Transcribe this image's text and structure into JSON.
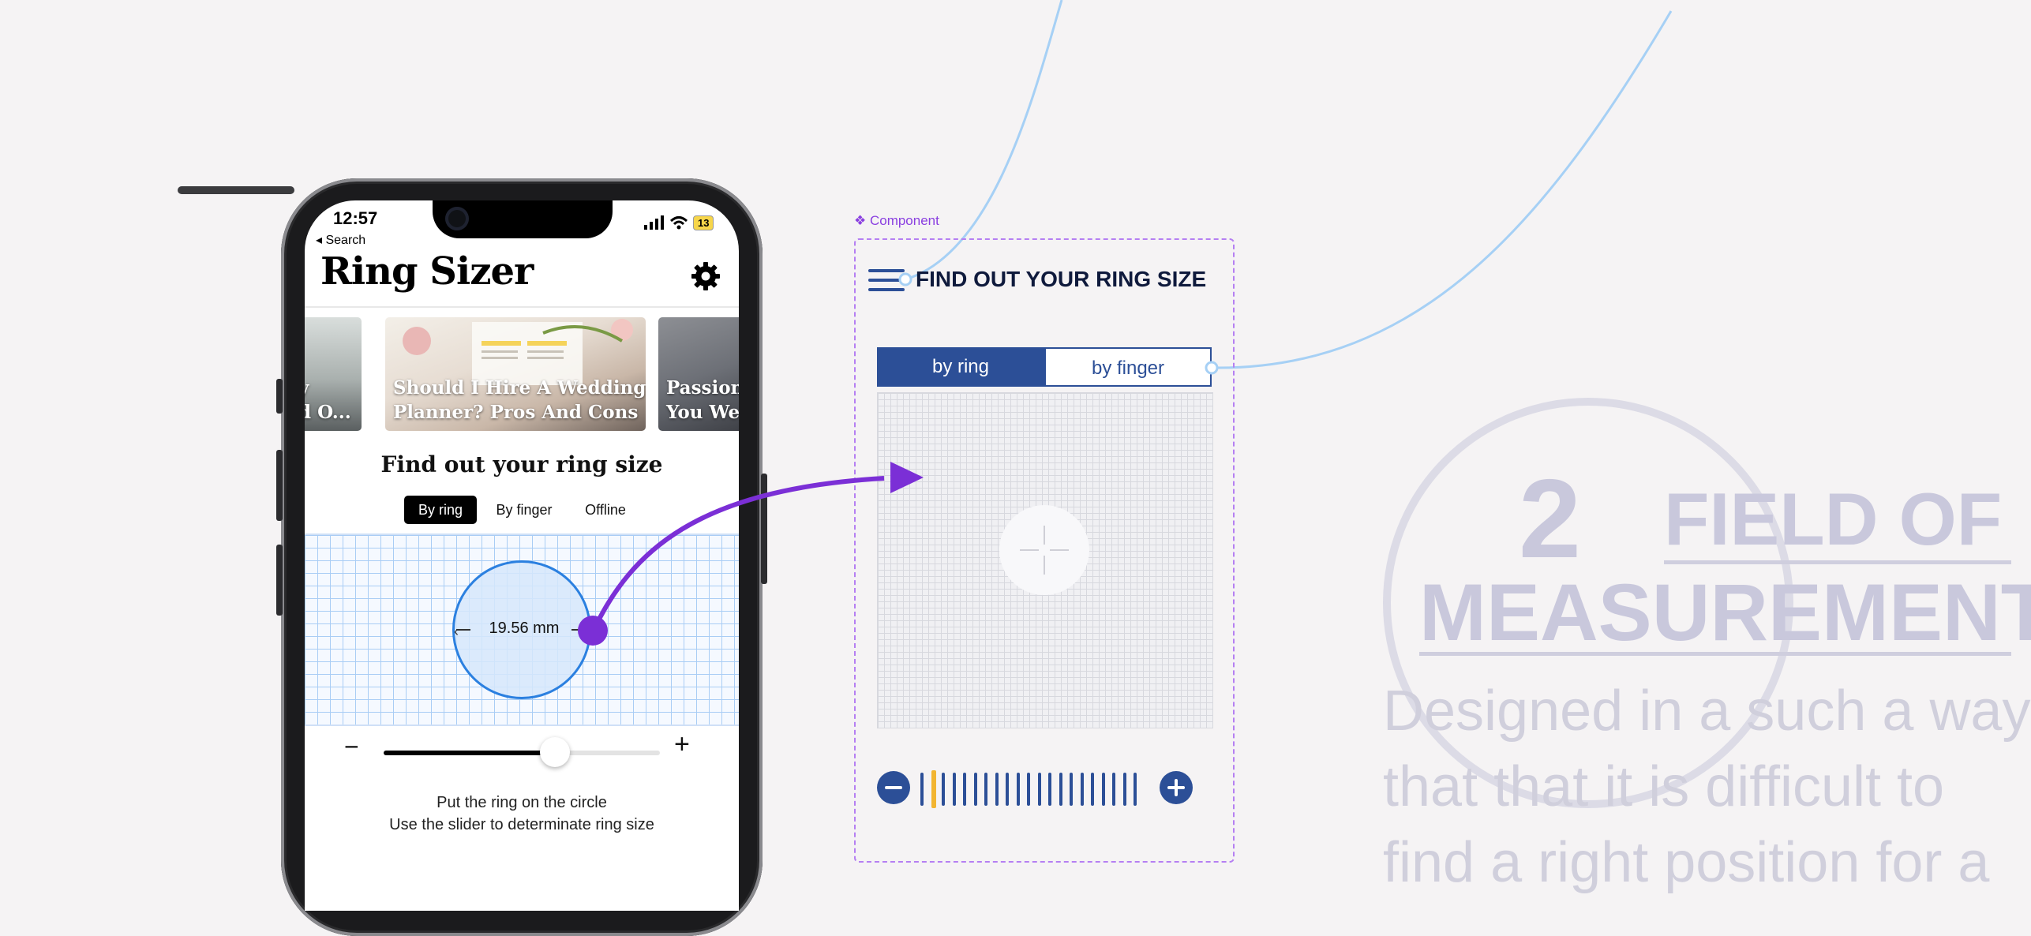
{
  "phone": {
    "status_time": "12:57",
    "back_label": "◂ Search",
    "battery": "13",
    "app_title": "Ring Sizer",
    "cards": [
      {
        "line1": "y",
        "line2": "d O..."
      },
      {
        "line1": "Should I Hire A Wedding",
        "line2": "Planner? Pros And Cons"
      },
      {
        "line1": "Passion",
        "line2": "You Wea"
      }
    ],
    "section_title": "Find out your ring size",
    "segments": [
      "By ring",
      "By finger",
      "Offline"
    ],
    "ring_size_label": "19.56 mm",
    "slider_value_fraction": 0.62,
    "slider_minus": "−",
    "slider_plus": "+",
    "hint_line1": "Put the ring on the circle",
    "hint_line2": "Use the slider to determinate ring size"
  },
  "component": {
    "tag_label": "❖ Component",
    "title": "FIND OUT YOUR RING SIZE",
    "tab_ring": "by ring",
    "tab_finger": "by finger"
  },
  "background_slide": {
    "number": "2",
    "heading_line1": "FIELD OF",
    "heading_line2": "MEASUREMENT",
    "body_line1": "Designed in a such a way",
    "body_line2": "that that it is difficult to",
    "body_line3": "find a right position for a"
  },
  "colors": {
    "accent_navy": "#2c4f97",
    "connector_purple": "#7b2fd6",
    "component_dash": "#b57ff2",
    "slider_highlight": "#f2b531"
  }
}
